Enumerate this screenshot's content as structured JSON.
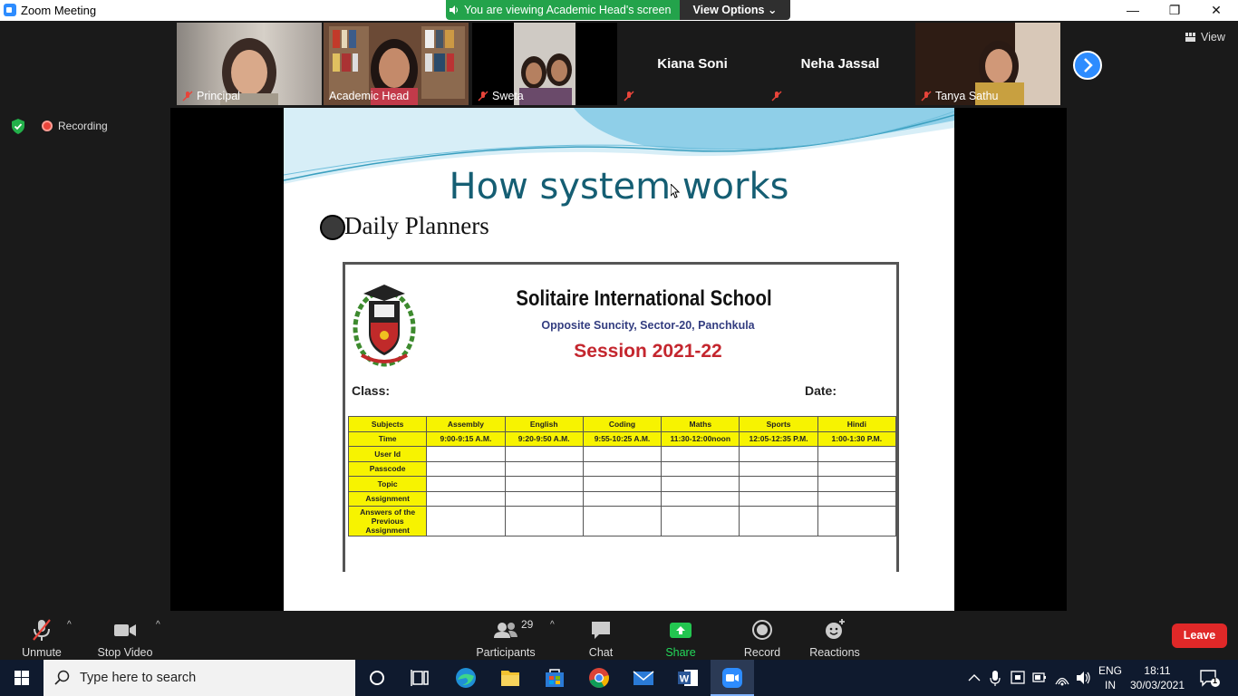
{
  "window": {
    "title": "Zoom Meeting",
    "minimize": "—",
    "restore": "❐",
    "close": "✕"
  },
  "banner": {
    "viewing_text": "You are viewing Academic Head's screen",
    "view_options": "View Options",
    "view_options_caret": "⌄"
  },
  "gallery": {
    "tiles": [
      {
        "name": "Principal",
        "muted": true
      },
      {
        "name": "Academic Head",
        "muted": false,
        "active": true
      },
      {
        "name": "Sweta",
        "muted": true
      },
      {
        "name": "Kiana Soni",
        "muted": true,
        "video": false
      },
      {
        "name": "Neha Jassal",
        "muted": true,
        "video": false
      },
      {
        "name": "Tanya Sathu",
        "muted": true
      }
    ],
    "view_label": "View"
  },
  "status": {
    "recording_label": "Recording"
  },
  "slide": {
    "title": "How system works",
    "bullet": "Daily Planners",
    "planner": {
      "school_name": "Solitaire International School",
      "address": "Opposite Suncity, Sector-20, Panchkula",
      "session": "Session 2021-22",
      "class_label": "Class:",
      "date_label": "Date:",
      "header_row": [
        "Subjects",
        "Assembly",
        "English",
        "Coding",
        "Maths",
        "Sports",
        "Hindi"
      ],
      "time_row": [
        "Time",
        "9:00-9:15 A.M.",
        "9:20-9:50 A.M.",
        "9:55-10:25 A.M.",
        "11:30-12:00noon",
        "12:05-12:35 P.M.",
        "1:00-1:30 P.M."
      ],
      "row_labels": [
        "User Id",
        "Passcode",
        "Topic",
        "Assignment",
        "Answers of the Previous Assignment"
      ]
    }
  },
  "toolbar": {
    "unmute": "Unmute",
    "stop_video": "Stop Video",
    "participants": "Participants",
    "participant_count": "29",
    "chat": "Chat",
    "share_screen": "Share Screen",
    "record": "Record",
    "reactions": "Reactions",
    "leave": "Leave",
    "caret": "^"
  },
  "taskbar": {
    "search_placeholder": "Type here to search",
    "lang_top": "ENG",
    "lang_bottom": "IN",
    "time": "18:11",
    "date": "30/03/2021",
    "notification_count": "1"
  },
  "colors": {
    "zoom_blue": "#2d8cff",
    "banner_green": "#23a34b",
    "leave_red": "#e02828",
    "slide_title": "#155e73",
    "table_yellow": "#f7f300",
    "session_red": "#c4262e"
  }
}
